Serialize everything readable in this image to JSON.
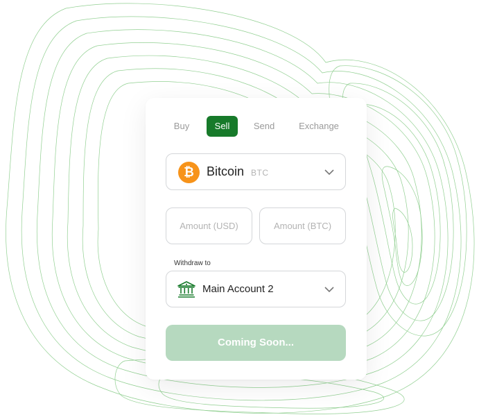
{
  "tabs": [
    {
      "label": "Buy",
      "active": false
    },
    {
      "label": "Sell",
      "active": true
    },
    {
      "label": "Send",
      "active": false
    },
    {
      "label": "Exchange",
      "active": false
    }
  ],
  "coin": {
    "name": "Bitcoin",
    "ticker": "BTC",
    "icon": "bitcoin-icon",
    "icon_symbol": "₿",
    "icon_color": "#f7931a"
  },
  "amount_usd": {
    "placeholder": "Amount (USD)",
    "value": ""
  },
  "amount_btc": {
    "placeholder": "Amount (BTC)",
    "value": ""
  },
  "withdraw": {
    "label": "Withdraw to",
    "account": "Main Account 2",
    "icon": "bank-icon"
  },
  "submit": {
    "label": "Coming Soon..."
  },
  "colors": {
    "accent": "#177a2a",
    "button_disabled": "#b6d9bf",
    "contour": "#5cb85c"
  }
}
